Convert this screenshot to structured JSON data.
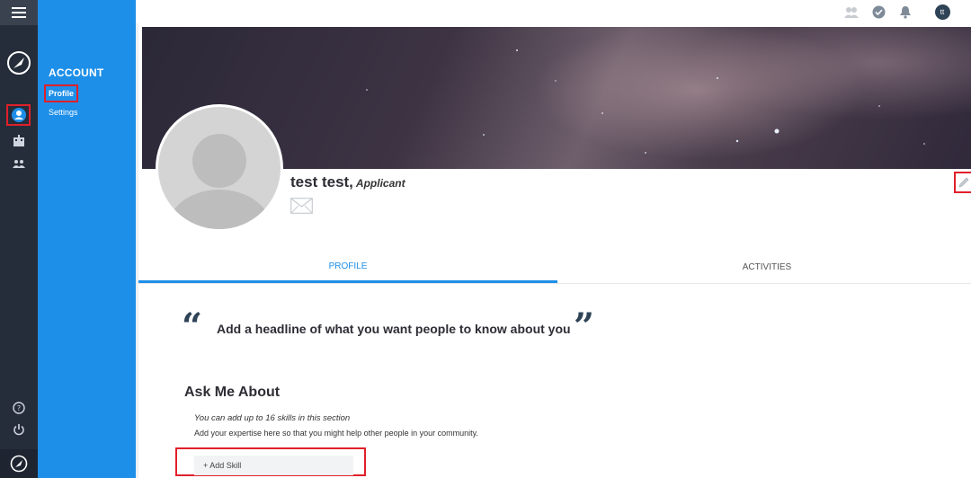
{
  "nav": {
    "heading": "ACCOUNT",
    "items": [
      {
        "label": "Profile",
        "active": true
      },
      {
        "label": "Settings",
        "active": false
      }
    ]
  },
  "topbar": {
    "icons": [
      "people-icon",
      "check-circle-icon",
      "bell-icon",
      "user-avatar"
    ],
    "avatar_initials": "tt"
  },
  "profile": {
    "name": "test test,",
    "role": "Applicant"
  },
  "tabs": [
    {
      "label": "PROFILE",
      "active": true
    },
    {
      "label": "ACTIVITIES",
      "active": false
    }
  ],
  "headline": {
    "placeholder": "Add a headline of what you want people to know about you",
    "open_quote": "“",
    "close_quote": "”"
  },
  "ask_me_about": {
    "title": "Ask Me About",
    "hint": "You can add up to 16 skills in this section",
    "description": "Add your expertise here so that you might help other people in your community.",
    "add_skill_label": "+ Add Skill"
  },
  "colors": {
    "rail": "#262d3a",
    "subnav": "#1e8fe8",
    "accent": "#1e8fe8",
    "highlight": "#e0202a"
  }
}
